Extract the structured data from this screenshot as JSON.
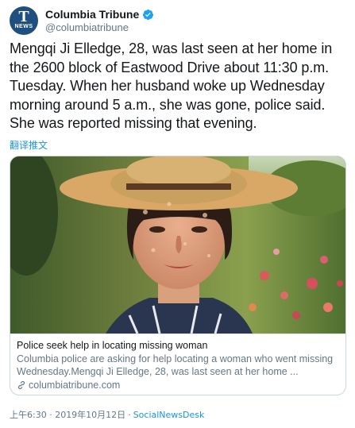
{
  "account": {
    "name": "Columbia Tribune",
    "handle": "@columbiatribune",
    "avatar_letter": "T",
    "avatar_label": "NEWS"
  },
  "tweet": {
    "text": "Mengqi Ji Elledge, 28, was last seen at her home in the 2600 block of Eastwood Drive about 11:30 p.m. Tuesday. When her husband woke up Wednesday morning around 5 a.m., she was gone, police said. She was reported missing that evening.",
    "translate_label": "翻译推文"
  },
  "card": {
    "title": "Police seek help in locating missing woman",
    "description": "Columbia police are asking for help locating a woman who went missing Wednesday.Mengqi Ji Elledge, 28, was last seen at her home ...",
    "domain": "columbiatribune.com"
  },
  "footer": {
    "timestamp": "上午6:30 · 2019年10月12日",
    "separator": "·",
    "source": "SocialNewsDesk"
  },
  "colors": {
    "link": "#1b95e0",
    "secondary_text": "#657786",
    "verified": "#1da1f2",
    "border": "#ccd6dd"
  },
  "icons": {
    "verified": "verified-badge-icon",
    "link": "link-icon"
  }
}
